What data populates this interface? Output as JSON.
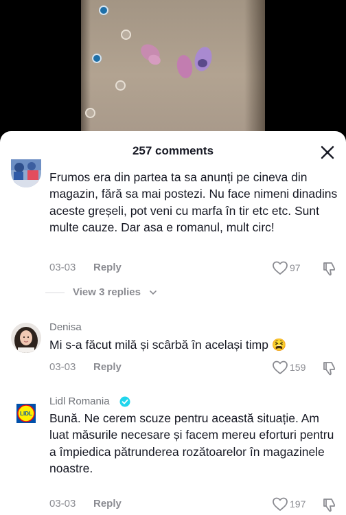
{
  "comments_panel": {
    "title": "257 comments"
  },
  "comments": [
    {
      "username": "",
      "text": "Frumos era din partea ta sa anunți pe cineva din magazin, fără sa mai postezi. Nu face nimeni dinadins aceste greșeli, pot veni cu marfa în tir etc etc. Sunt multe cauze. Dar asa e romanul, mult circ!",
      "date": "03-03",
      "reply_label": "Reply",
      "likes": "97",
      "view_replies": "View 3 replies"
    },
    {
      "username": "Denisa",
      "text": "Mi s-a făcut milă și scârbă în același timp 😫",
      "date": "03-03",
      "reply_label": "Reply",
      "likes": "159"
    },
    {
      "username": "Lidl Romania",
      "verified": true,
      "avatar_logo_text": "LIDL",
      "text": "Bună. Ne cerem scuze pentru această situație. Am luat măsurile necesare și facem mereu eforturi pentru a împiedica pătrunderea rozătoarelor în magazinele noastre.",
      "date": "03-03",
      "reply_label": "Reply",
      "likes": "197"
    }
  ],
  "icons": {
    "close": "close-icon",
    "like": "heart-outline-icon",
    "dislike": "thumbs-down-icon",
    "verified": "verified-badge-icon",
    "chevron": "chevron-down-icon"
  },
  "colors": {
    "text_primary": "#161823",
    "text_secondary": "#8a8b91",
    "verified": "#20d5ec",
    "lidl_blue": "#0050aa",
    "lidl_yellow": "#fff000",
    "lidl_red": "#e60a14"
  }
}
